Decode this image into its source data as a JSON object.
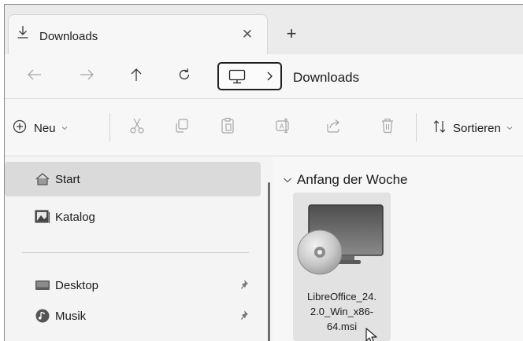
{
  "tab": {
    "title": "Downloads",
    "close_glyph": "✕",
    "icon": "download-icon"
  },
  "new_tab_glyph": "+",
  "navigation": {
    "back_icon": "arrow-left-icon",
    "forward_icon": "arrow-right-icon",
    "up_icon": "arrow-up-icon",
    "refresh_icon": "refresh-icon",
    "address_root_icon": "computer-icon",
    "address_separator_icon": "chevron-right-icon",
    "address_segment": "Downloads"
  },
  "commandbar": {
    "new_label": "Neu",
    "sort_label": "Sortieren",
    "icons": [
      "cut-icon",
      "copy-icon",
      "paste-icon",
      "rename-icon",
      "share-icon",
      "delete-icon"
    ]
  },
  "sidebar": {
    "items": [
      {
        "label": "Start",
        "icon": "home-icon",
        "selected": true,
        "pinned": false
      },
      {
        "label": "Katalog",
        "icon": "gallery-icon",
        "selected": false,
        "pinned": false
      },
      {
        "label": "Desktop",
        "icon": "desktop-icon",
        "selected": false,
        "pinned": true
      },
      {
        "label": "Musik",
        "icon": "music-icon",
        "selected": false,
        "pinned": true
      }
    ]
  },
  "content": {
    "group_header": "Anfang der Woche",
    "files": [
      {
        "name": "LibreOffice_24.\n2.0_Win_x86-\n64.msi",
        "icon": "msi-installer-icon"
      }
    ]
  }
}
